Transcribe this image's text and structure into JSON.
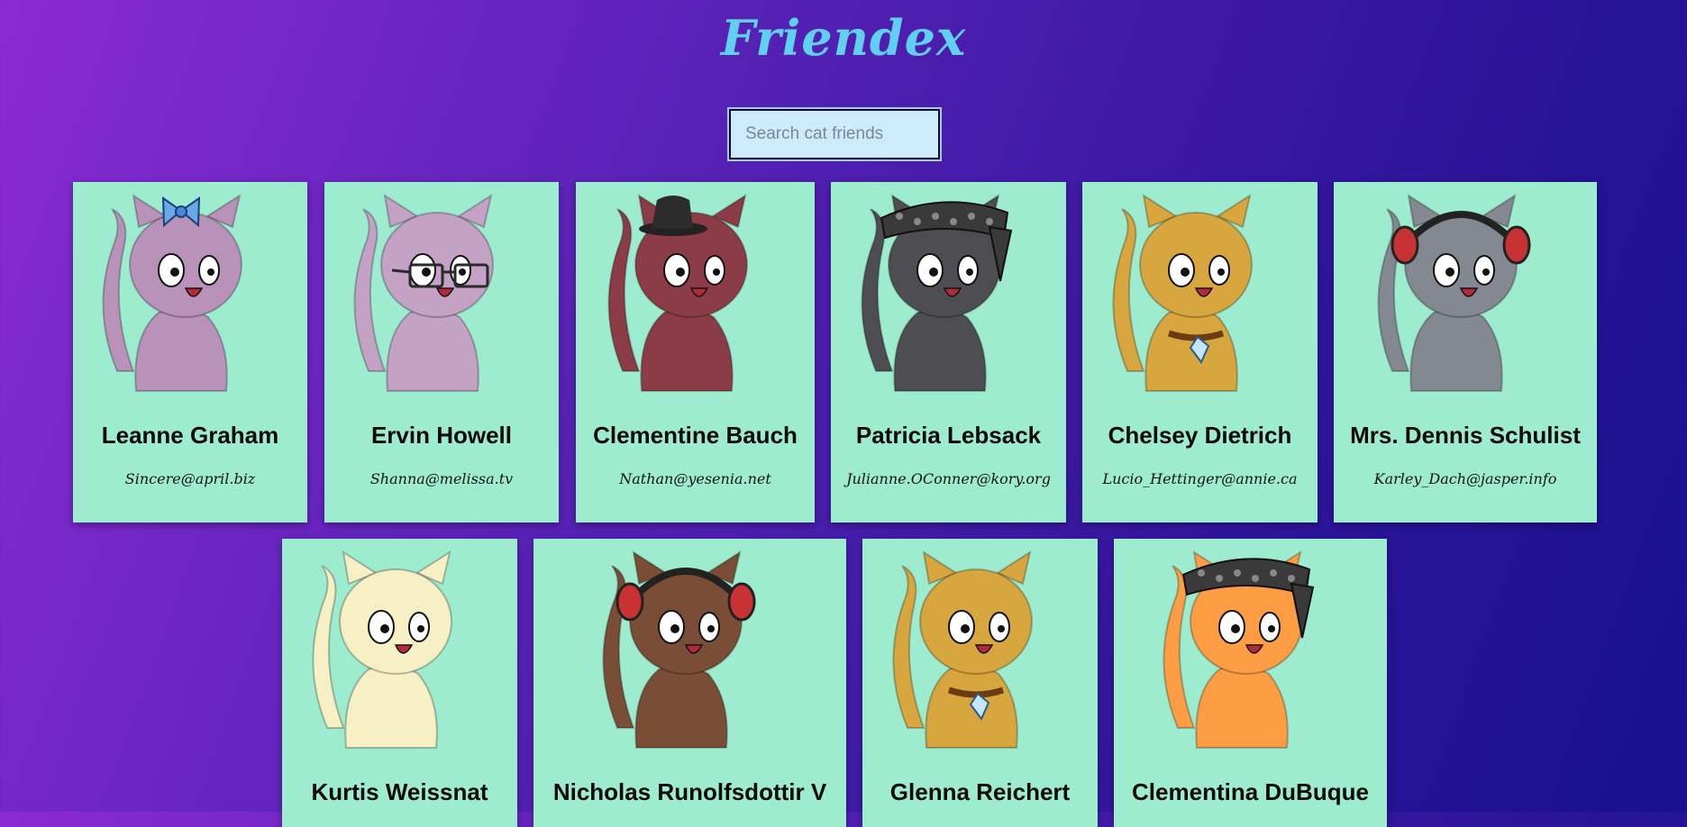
{
  "app": {
    "title": "Friendex"
  },
  "search": {
    "placeholder": "Search cat friends",
    "value": ""
  },
  "cards": [
    {
      "name": "Leanne Graham",
      "email": "Sincere@april.biz",
      "color": "#b892b8",
      "accessory": "bow-icon"
    },
    {
      "name": "Ervin Howell",
      "email": "Shanna@melissa.tv",
      "color": "#c4a2c6",
      "accessory": "glasses-icon"
    },
    {
      "name": "Clementine Bauch",
      "email": "Nathan@yesenia.net",
      "color": "#8c3c46",
      "accessory": "hat-icon"
    },
    {
      "name": "Patricia Lebsack",
      "email": "Julianne.OConner@kory.org",
      "color": "#4e4e52",
      "accessory": "bandana-icon"
    },
    {
      "name": "Chelsey Dietrich",
      "email": "Lucio_Hettinger@annie.ca",
      "color": "#d8a63e",
      "accessory": "collar-icon"
    },
    {
      "name": "Mrs. Dennis Schulist",
      "email": "Karley_Dach@jasper.info",
      "color": "#838891",
      "accessory": "headphones-icon"
    },
    {
      "name": "Kurtis Weissnat",
      "email": "",
      "color": "#f6f0c4",
      "accessory": ""
    },
    {
      "name": "Nicholas Runolfsdottir V",
      "email": "",
      "color": "#7a4e36",
      "accessory": "headphones-icon"
    },
    {
      "name": "Glenna Reichert",
      "email": "",
      "color": "#d8a63e",
      "accessory": "collar-icon"
    },
    {
      "name": "Clementina DuBuque",
      "email": "",
      "color": "#ff9d44",
      "accessory": "bandana-icon"
    }
  ]
}
